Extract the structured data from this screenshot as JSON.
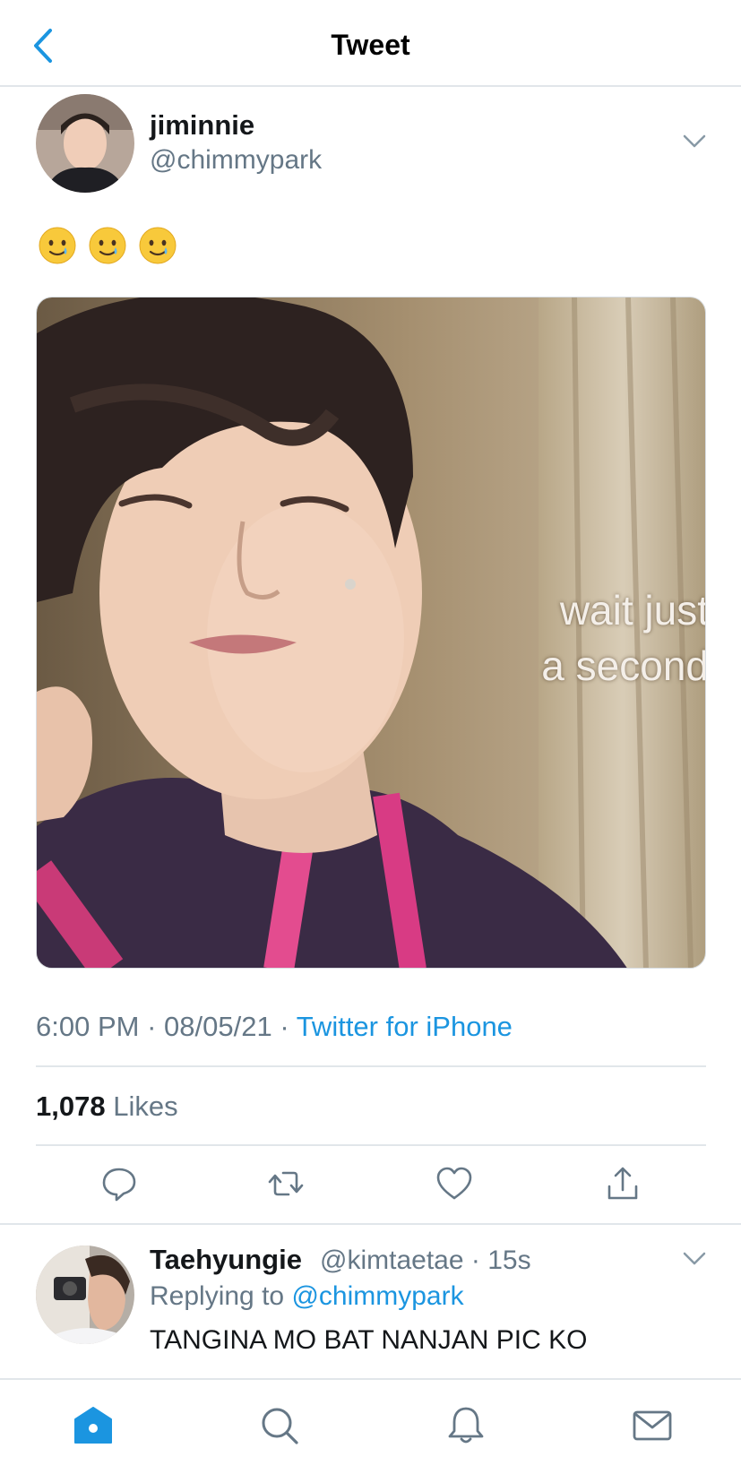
{
  "nav": {
    "title": "Tweet",
    "back_icon": "chevron-left-icon"
  },
  "tweet": {
    "display_name": "jiminnie",
    "handle": "@chimmypark",
    "emojis": [
      "🥲",
      "🥲",
      "🥲"
    ],
    "media_caption_line1": "wait just",
    "media_caption_line2": "a second",
    "time": "6:00 PM",
    "date": "08/05/21",
    "source": "Twitter for iPhone",
    "likes_count": "1,078",
    "likes_label": "Likes"
  },
  "reply": {
    "display_name": "Taehyungie",
    "handle": "@kimtaetae",
    "time": "15s",
    "replying_prefix": "Replying to",
    "replying_to": "@chimmypark",
    "text": "TANGINA MO BAT NANJAN PIC KO"
  },
  "colors": {
    "accent": "#1b95e0",
    "muted": "#657786",
    "divider": "#e1e6ea"
  },
  "tabbar": {
    "items": [
      "home-icon",
      "search-icon",
      "bell-icon",
      "mail-icon"
    ],
    "active": "home-icon"
  }
}
